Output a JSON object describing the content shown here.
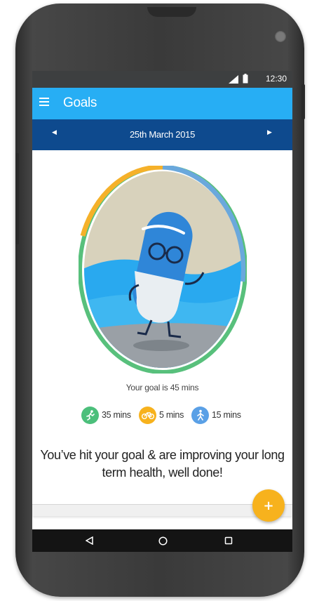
{
  "status_bar": {
    "time": "12:30",
    "icons": [
      "signal-icon",
      "battery-icon"
    ]
  },
  "app_bar": {
    "title": "Goals",
    "menu_icon": "hamburger-menu-icon"
  },
  "date_bar": {
    "date": "25th March 2015",
    "prev_icon": "chevron-left-icon",
    "next_icon": "chevron-right-icon"
  },
  "goal": {
    "text": "Your goal is 45 mins",
    "activities": [
      {
        "icon": "running-icon",
        "label": "35 mins",
        "color": "#4cbf7b"
      },
      {
        "icon": "bicycle-icon",
        "label": "5 mins",
        "color": "#f7b21d"
      },
      {
        "icon": "walking-icon",
        "label": "15 mins",
        "color": "#5aa0e6"
      }
    ],
    "message": "You’ve hit your goal & are improving your long term health, well done!"
  },
  "fab": {
    "label": "+"
  },
  "colors": {
    "app_bar": "#27aef4",
    "date_bar": "#0e4a8e",
    "fab": "#f7b21d",
    "ring_green": "#58c07c",
    "ring_orange": "#f5b12a",
    "ring_blue": "#6aa8dc"
  },
  "nav": {
    "icons": [
      "back-icon",
      "home-icon",
      "recents-icon"
    ]
  }
}
